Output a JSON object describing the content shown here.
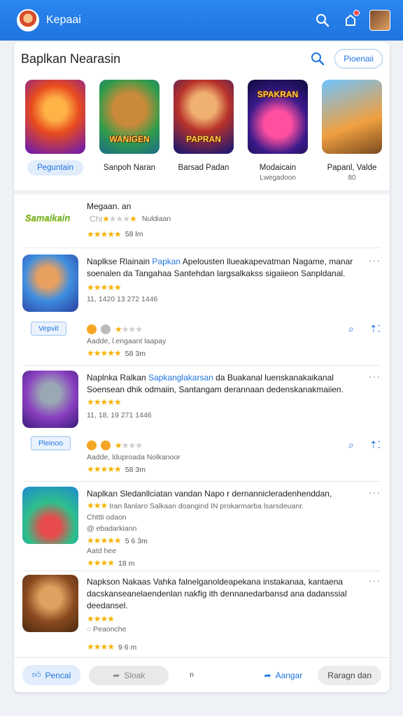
{
  "topbar": {
    "title": "Kepaai"
  },
  "section": {
    "title": "Baplkan Nearasin",
    "pill_label": "Pioenaii"
  },
  "featured": [
    {
      "label": "Peguntain",
      "sub": "",
      "selected": true,
      "caption": ""
    },
    {
      "label": "Sanpoh Naran",
      "sub": "",
      "selected": false,
      "caption": "WANIGEN"
    },
    {
      "label": "Barsad Padan",
      "sub": "",
      "selected": false,
      "caption": "PAPRAN"
    },
    {
      "label": "Modaicain",
      "sub": "Lwegadoon",
      "selected": false,
      "caption": "SPAKRAN"
    },
    {
      "label": "Papanl, Valde",
      "sub": "80",
      "selected": false,
      "caption": ""
    }
  ],
  "promo": {
    "logo": "Samaikain",
    "title": "Megaan. an",
    "sub_text": "Chi",
    "sub_note": "Nuldiaan",
    "rating": "58 lm"
  },
  "posts": [
    {
      "name": "Naplkse Rlainain",
      "highlight": "Papkan",
      "text": "Apelousten llueakapevatman Nagame, manar soenalen da Tangahaa Santehdan largsalkakss sigaiieon Sanpldanal.",
      "date": "11, 1420 13 272 1446",
      "tag": "Vepvit",
      "reaction_note": "Aadde, l.engaant laapay",
      "rating": "58 3m"
    },
    {
      "name": "Naplnka Ralkan",
      "highlight": "Sapkanglakarsan",
      "text": "da Buakanal luenskanakaikanal Soensean dhik odmaiin, Santangam derannaan dedenskanakmaiien.",
      "date": "11, 18, 19 271 1446",
      "tag": "Pleinoo",
      "reaction_note": "Aadde, lduproada Nolkanoor",
      "rating": "58 3m"
    },
    {
      "name": "Naplkan Sledanllciatan",
      "highlight": "",
      "text": "vandan Napo r dernannicleradenhenddan,",
      "line2": "Iran llanlaro Salkaan doangind IN prokarmarba lsarsdeuanr.",
      "line3": "Chttti odaon",
      "line4": "@ ebadarkiann",
      "rating_a": "5 6 3m",
      "rating_b_note": "Aatd hee",
      "rating_b": "18 m"
    },
    {
      "name": "Napkson Nakaas",
      "highlight": "",
      "text": "Vahka falnelganoldeapekana instakanaa, kantaena dacskanseanelaendenlan nakfig ith dennanedarbansd ana dadanssial deedansel.",
      "note": "Peaonche",
      "rating": "9 6 m"
    }
  ],
  "bottom": {
    "like_label": "Pencal",
    "share_label": "Sloak",
    "dots": "n",
    "anger_label": "Aangar",
    "regn_label": "Raragn dan"
  }
}
